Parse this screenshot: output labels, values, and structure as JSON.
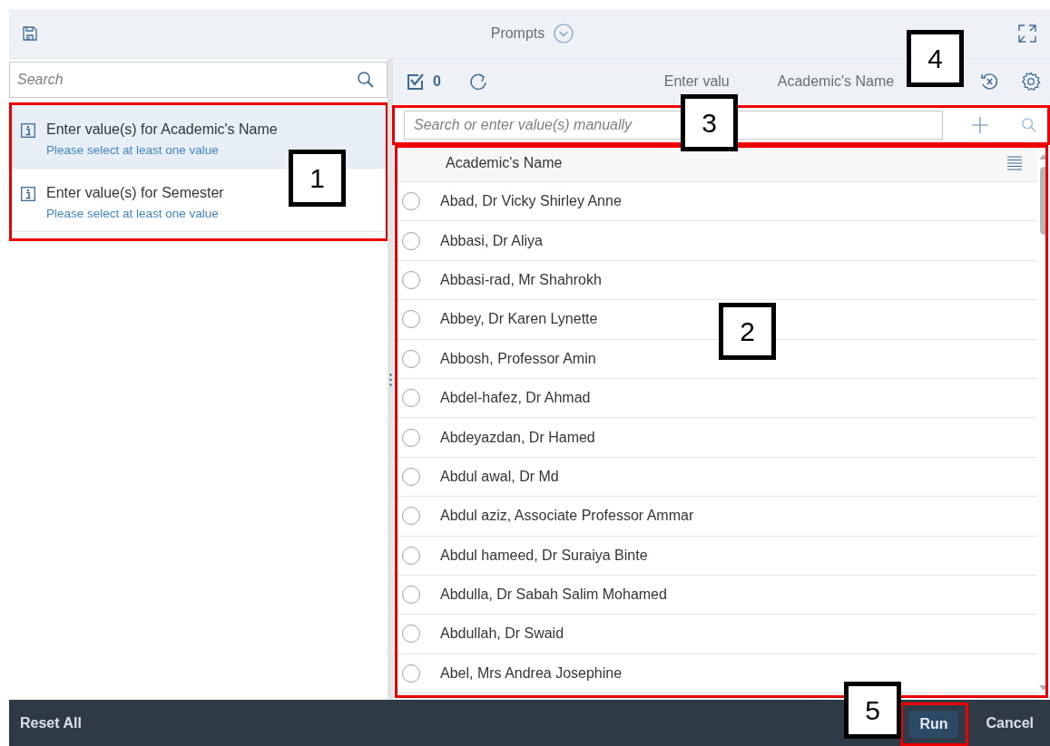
{
  "window": {
    "title": "Prompts"
  },
  "prompt_search": {
    "placeholder": "Search"
  },
  "prompts": [
    {
      "label": "Enter value(s) for Academic's Name",
      "hint": "Please select at least one value",
      "selected": true
    },
    {
      "label": "Enter value(s) for Semester",
      "hint": "Please select at least one value",
      "selected": false
    }
  ],
  "toolbar": {
    "selected_count": "0",
    "title_parts": [
      "Enter valu",
      "Academic's Name"
    ]
  },
  "value_search": {
    "placeholder": "Search or enter value(s) manually"
  },
  "list": {
    "column": "Academic's Name",
    "rows": [
      {
        "name": "Abad, Dr Vicky Shirley Anne",
        "selected": false
      },
      {
        "name": "Abbasi, Dr Aliya",
        "selected": false
      },
      {
        "name": "Abbasi-rad, Mr Shahrokh",
        "selected": false
      },
      {
        "name": "Abbey, Dr Karen Lynette",
        "selected": false
      },
      {
        "name": "Abbosh, Professor Amin",
        "selected": false
      },
      {
        "name": "Abdel-hafez, Dr Ahmad",
        "selected": false
      },
      {
        "name": "Abdeyazdan, Dr Hamed",
        "selected": false
      },
      {
        "name": "Abdul awal, Dr Md",
        "selected": false
      },
      {
        "name": "Abdul aziz, Associate Professor Ammar",
        "selected": false
      },
      {
        "name": "Abdul hameed, Dr Suraiya Binte",
        "selected": false
      },
      {
        "name": "Abdulla, Dr Sabah Salim Mohamed",
        "selected": false
      },
      {
        "name": "Abdullah, Dr Swaid",
        "selected": false
      },
      {
        "name": "Abel, Mrs Andrea Josephine",
        "selected": false
      }
    ]
  },
  "footer": {
    "reset": "Reset All",
    "run": {
      "label": "Run",
      "disabled": true
    },
    "cancel": "Cancel"
  },
  "annotations": [
    {
      "number": "1"
    },
    {
      "number": "2"
    },
    {
      "number": "3"
    },
    {
      "number": "4"
    },
    {
      "number": "5"
    }
  ]
}
